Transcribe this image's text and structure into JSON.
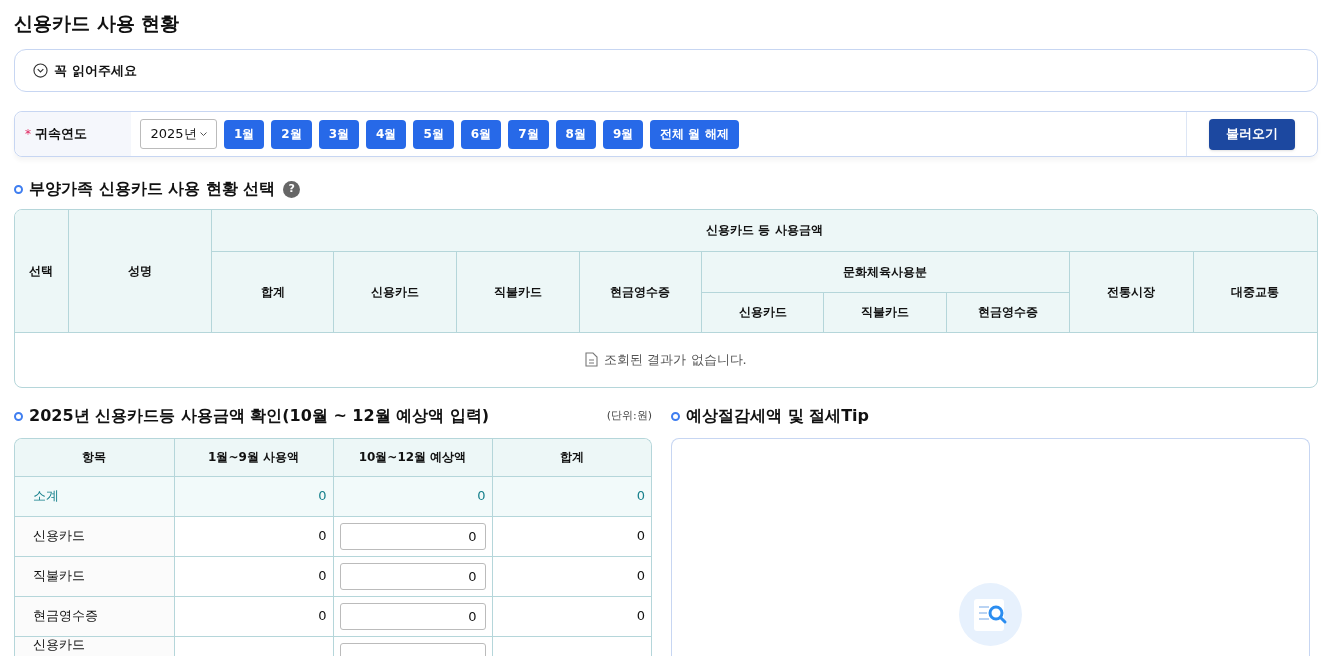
{
  "page_title": "신용카드 사용 현황",
  "notice": {
    "label": "꼭 읽어주세요",
    "expanded": false
  },
  "filter": {
    "label": "귀속연도",
    "required_mark": "*",
    "year": "2025년",
    "months": [
      "1월",
      "2월",
      "3월",
      "4월",
      "5월",
      "6월",
      "7월",
      "8월",
      "9월"
    ],
    "clear_button": "전체 월 해제",
    "load_button": "불러오기"
  },
  "family_section": {
    "heading": "부양가족 신용카드 사용 현황 선택",
    "help": "?",
    "columns": {
      "select": "선택",
      "name": "성명",
      "group": "신용카드 등 사용금액",
      "total": "합계",
      "credit": "신용카드",
      "debit": "직불카드",
      "cash": "현금영수증",
      "culture": "문화체육사용분",
      "culture_sub": [
        "신용카드",
        "직불카드",
        "현금영수증"
      ],
      "market": "전통시장",
      "transit": "대중교통"
    },
    "empty_message": "조회된 결과가 없습니다."
  },
  "usage_section": {
    "heading": "2025년 신용카드등 사용금액 확인(10월 ~ 12월 예상액 입력)",
    "unit": "(단위:원)",
    "columns": [
      "항목",
      "1월~9월 사용액",
      "10월~12월 예상액",
      "합계"
    ],
    "rows": [
      {
        "kind": "subtotal",
        "label": "소계",
        "used": "0",
        "expected": "0",
        "total": "0"
      },
      {
        "kind": "input",
        "label": "신용카드",
        "used": "0",
        "expected": "0",
        "total": "0"
      },
      {
        "kind": "input",
        "label": "직불카드",
        "used": "0",
        "expected": "0",
        "total": "0"
      },
      {
        "kind": "input",
        "label": "현금영수증",
        "used": "0",
        "expected": "0",
        "total": "0"
      },
      {
        "kind": "input",
        "label": "신용카드"
      }
    ]
  },
  "tips_section": {
    "heading": "예상절감세액 및 절세Tip"
  }
}
